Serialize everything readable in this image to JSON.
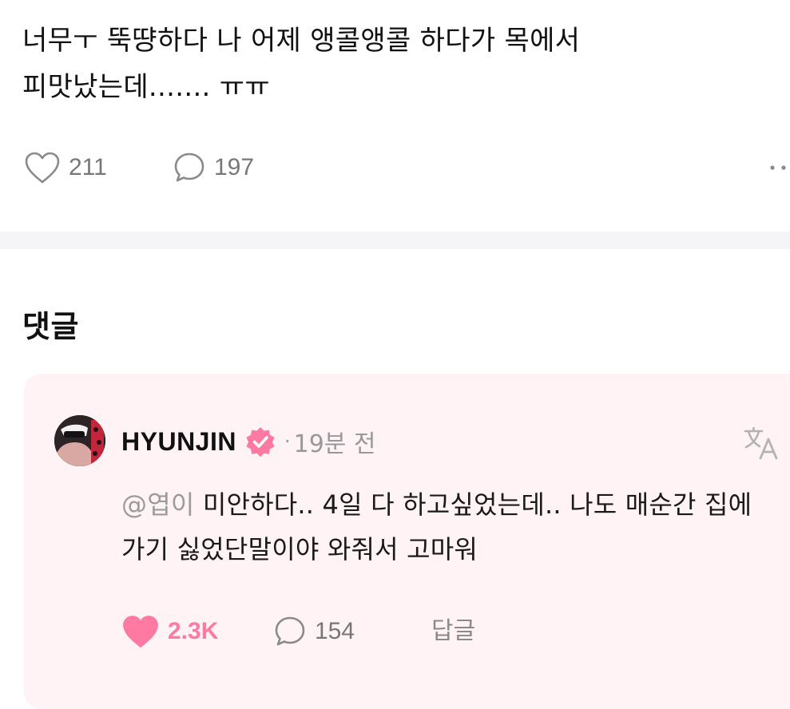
{
  "post": {
    "text": "너무ㅜ 뚝땽하다 나 어제 앵콜앵콜 하다가 목에서\n피맛났는데....... ㅠㅠ",
    "like_count": "211",
    "comment_count": "197"
  },
  "comments_section": {
    "title": "댓글"
  },
  "comment": {
    "author": "HYUNJIN",
    "separator": "·",
    "time": "19분 전",
    "mention": "@엽이",
    "text": " 미안하다.. 4일 다 하고싶었는데.. 나도 매순간 집에 가기 싫었단말이야 와줘서 고마워",
    "like_count": "2.3K",
    "reply_count": "154",
    "reply_label": "답글"
  },
  "icons": {
    "post_like": "heart-outline-icon",
    "post_comment": "speech-bubble-icon",
    "more": "more-dots-icon",
    "verified": "verified-badge-icon",
    "translate": "translate-icon",
    "comment_like": "heart-filled-icon",
    "comment_reply": "speech-bubble-icon"
  },
  "colors": {
    "accent_pink": "#ff7aa2",
    "card_background": "#fff3f6",
    "muted_text": "#999999"
  }
}
